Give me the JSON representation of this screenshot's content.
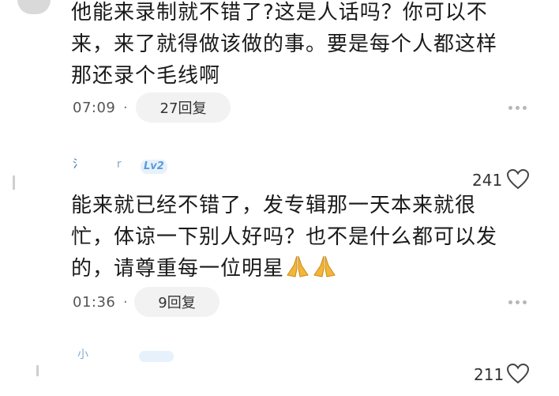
{
  "comments": [
    {
      "text_lines": [
        "他能来录制就不错了?这是人话吗？你可以不",
        "来，来了就得做该做的事。要是每个人都这样",
        "那还录个毛线啊"
      ],
      "time": "07:09",
      "replies": "27回复"
    },
    {
      "username": "氵",
      "level": "Lv2",
      "likes": "241",
      "text_lines": [
        "能来就已经不错了，发专辑那一天本来就很",
        "忙，体谅一下别人好吗？也不是什么都可以发",
        "的，请尊重每一位明星"
      ],
      "emoji": [
        "pray-emoji",
        "pray-emoji"
      ],
      "time": "01:36",
      "replies": "9回复"
    },
    {
      "username": "小",
      "likes": "211"
    }
  ],
  "separator": "·",
  "icons": {
    "like": "heart-outline-icon",
    "more": "more-dots-icon"
  },
  "colors": {
    "username": "#2f6fb5",
    "level_badge": "#5a9ad8",
    "pill_bg": "#f2f2f2",
    "emoji": "#f4b63a"
  }
}
